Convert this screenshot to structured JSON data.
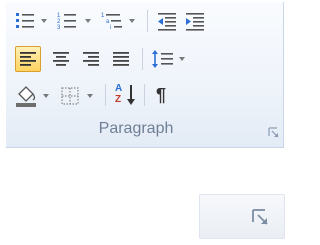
{
  "group": {
    "label": "Paragraph"
  },
  "buttons": {
    "row1": [
      "bullets",
      "numbering",
      "multilevel-list",
      "decrease-indent",
      "increase-indent"
    ],
    "row2": [
      "align-left",
      "center",
      "align-right",
      "justify",
      "line-spacing"
    ],
    "row3": [
      "shading",
      "borders",
      "sort",
      "show-formatting-marks"
    ]
  },
  "state": {
    "pressed": "align-left"
  },
  "glyphs": {
    "pilcrow": "¶",
    "sort_top": "A",
    "sort_bottom": "Z"
  },
  "colors": {
    "accent_bullet": "#2b6fd6",
    "pressed_bg": "#ffd35e",
    "label": "#6f7f96"
  }
}
